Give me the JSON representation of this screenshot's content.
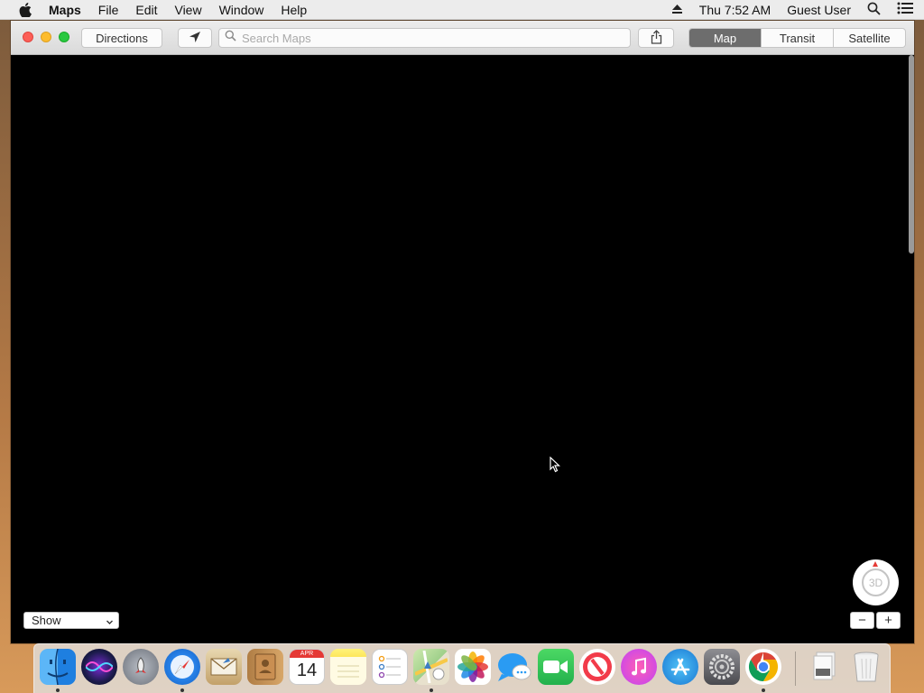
{
  "menubar": {
    "app_name": "Maps",
    "items": [
      "File",
      "Edit",
      "View",
      "Window",
      "Help"
    ],
    "clock": "Thu 7:52 AM",
    "user": "Guest User"
  },
  "toolbar": {
    "directions_label": "Directions",
    "search_placeholder": "Search Maps",
    "modes": [
      "Map",
      "Transit",
      "Satellite"
    ],
    "active_mode": "Map"
  },
  "map": {
    "show_select_value": "Show",
    "compass_label": "3D",
    "zoom_out_label": "−",
    "zoom_in_label": "+"
  },
  "dock": {
    "calendar_month": "APR",
    "calendar_day": "14",
    "apps": [
      "Finder",
      "Siri",
      "Launchpad",
      "Safari",
      "Mail",
      "Contacts",
      "Calendar",
      "Notes",
      "Reminders",
      "Maps",
      "Photos",
      "Messages",
      "FaceTime",
      "News",
      "iTunes",
      "App Store",
      "System Preferences",
      "Chrome",
      "Downloads",
      "Trash"
    ]
  },
  "colors": {
    "close": "#fc5f57",
    "minimize": "#fdbc2e",
    "maximize": "#29c840",
    "segment_active": "#6d6d6d",
    "map_background": "#000000"
  }
}
